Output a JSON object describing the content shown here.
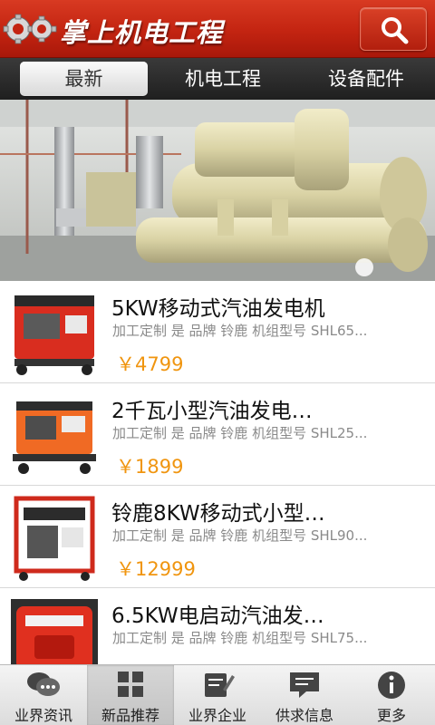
{
  "header": {
    "title": "掌上机电工程",
    "logo_icon": "gears-logo-icon",
    "search_icon": "search-icon",
    "brand_color": "#c32411"
  },
  "tabs": [
    {
      "label": "最新",
      "active": true
    },
    {
      "label": "机电工程",
      "active": false
    },
    {
      "label": "设备配件",
      "active": false
    }
  ],
  "banner": {
    "image": "industrial-chiller-machinery-photo",
    "slide_indicator": "dot"
  },
  "products": [
    {
      "title": "5KW移动式汽油发电机",
      "desc": "加工定制 是 品牌 铃鹿 机组型号 SHL65...",
      "price": "￥4799",
      "image": "red-generator-photo"
    },
    {
      "title": "2千瓦小型汽油发电…",
      "desc": "加工定制 是 品牌 铃鹿 机组型号 SHL25...",
      "price": "￥1899",
      "image": "orange-generator-photo"
    },
    {
      "title": "铃鹿8KW移动式小型…",
      "desc": "加工定制 是 品牌 铃鹿 机组型号 SHL90...",
      "price": "￥12999",
      "image": "red-frame-generator-photo"
    },
    {
      "title": "6.5KW电启动汽油发…",
      "desc": "加工定制 是 品牌 铃鹿 机组型号 SHL75...",
      "price": "",
      "image": "red-enclosed-generator-photo"
    }
  ],
  "price_color": "#f0950f",
  "bottom_nav": [
    {
      "label": "业界资讯",
      "icon": "chat-bubbles-icon",
      "active": false
    },
    {
      "label": "新品推荐",
      "icon": "grid-icon",
      "active": true
    },
    {
      "label": "业界企业",
      "icon": "edit-icon",
      "active": false
    },
    {
      "label": "供求信息",
      "icon": "message-icon",
      "active": false
    },
    {
      "label": "更多",
      "icon": "info-icon",
      "active": false
    }
  ]
}
